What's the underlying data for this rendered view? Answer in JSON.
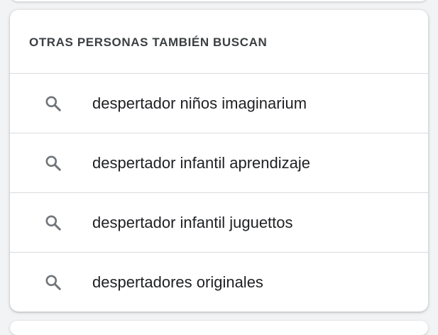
{
  "section": {
    "title": "OTRAS PERSONAS TAMBIÉN BUSCAN",
    "items": [
      {
        "label": "despertador niños imaginarium",
        "icon": "search-icon"
      },
      {
        "label": "despertador infantil aprendizaje",
        "icon": "search-icon"
      },
      {
        "label": "despertador infantil juguettos",
        "icon": "search-icon"
      },
      {
        "label": "despertadores originales",
        "icon": "search-icon"
      }
    ]
  },
  "colors": {
    "background": "#f1f3f4",
    "card": "#ffffff",
    "divider": "#dadce0",
    "title_text": "#3c4043",
    "item_text": "#202124",
    "icon": "#70757a"
  }
}
